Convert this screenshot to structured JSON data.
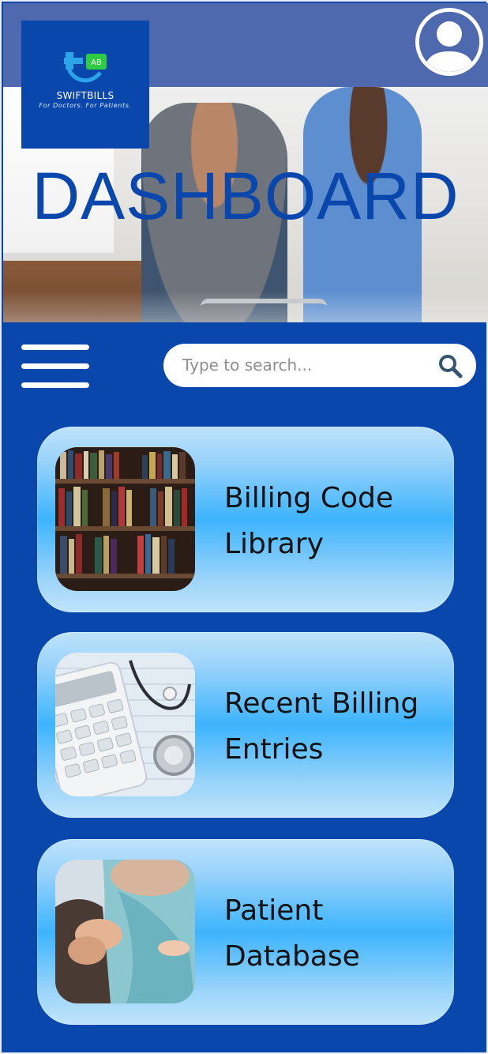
{
  "brand": {
    "badge": "AB",
    "name": "SWIFTBILLS",
    "tagline": "For Doctors. For Patients."
  },
  "header": {
    "title": "DASHBOARD",
    "profile_icon": "user-circle-icon"
  },
  "toolbar": {
    "menu_icon": "hamburger-menu-icon",
    "search_placeholder": "Type to search...",
    "search_icon": "search-icon"
  },
  "cards": [
    {
      "label": "Billing Code\nLibrary",
      "image": "bookshelf-image"
    },
    {
      "label": "Recent Billing\nEntries",
      "image": "calculator-stethoscope-image"
    },
    {
      "label": "Patient\nDatabase",
      "image": "holding-hands-image"
    }
  ],
  "colors": {
    "primary_blue": "#0a47ad",
    "topbar": "#4f69ae",
    "card_accent": "#3db4fd",
    "logo_green": "#2ecc40"
  }
}
